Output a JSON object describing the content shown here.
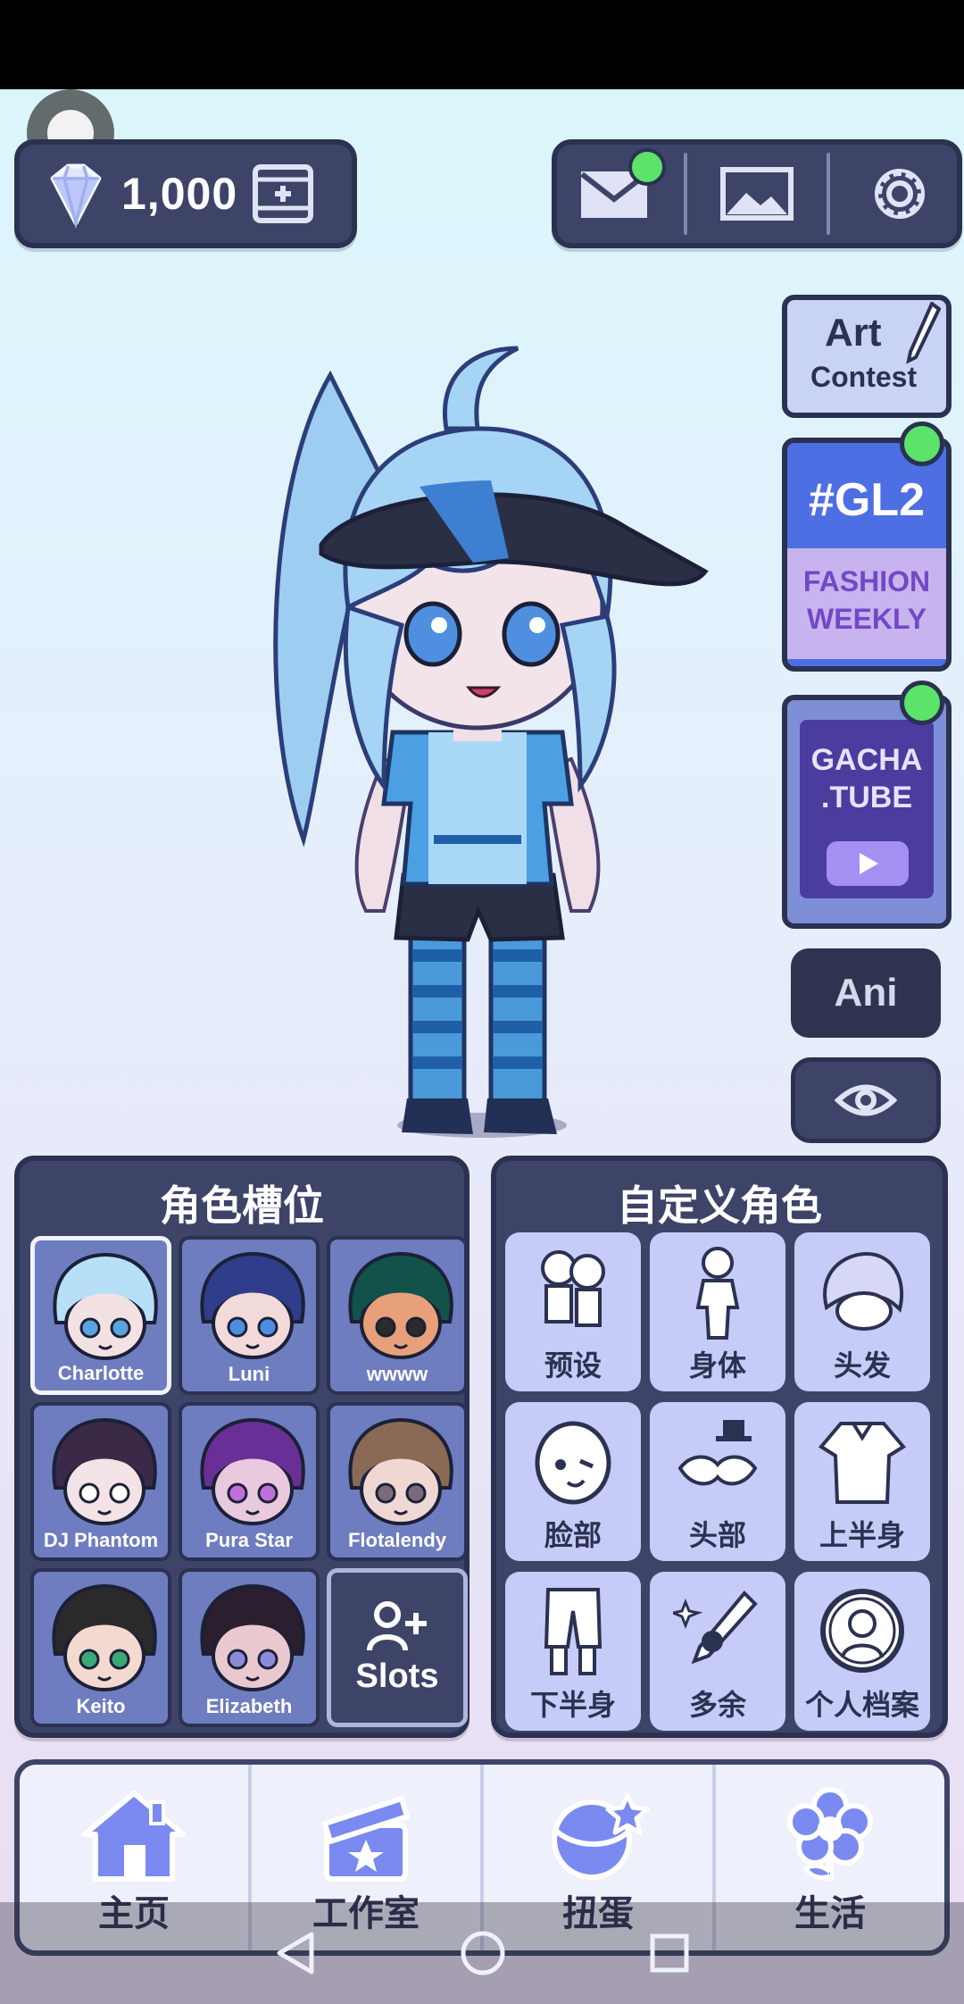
{
  "currency": {
    "gems": "1,000"
  },
  "top_buttons": [
    "mail-icon",
    "gallery-icon",
    "gear-icon"
  ],
  "side": {
    "art_contest": {
      "line1": "Art",
      "line2": "Contest"
    },
    "gl2": {
      "title": "#GL2",
      "line1": "FASHION",
      "line2": "WEEKLY"
    },
    "gacha_tube": {
      "line1": "GACHA",
      "line2": ".TUBE"
    },
    "ani_label": "Ani"
  },
  "slots_panel": {
    "title": "角色槽位",
    "slots": [
      {
        "name": "Charlotte",
        "hair": "#b7dff7",
        "skin": "#f3e2e4",
        "eye": "#5aa4de"
      },
      {
        "name": "Luni",
        "hair": "#2f3d8a",
        "skin": "#f3dada",
        "eye": "#4d8ee3"
      },
      {
        "name": "wwww",
        "hair": "#12524a",
        "skin": "#e8a07a",
        "eye": "#2b2b2b"
      },
      {
        "name": "DJ Phantom",
        "hair": "#3a2a48",
        "skin": "#f3e2e6",
        "eye": "#ffffff"
      },
      {
        "name": "Pura Star",
        "hair": "#6a2f96",
        "skin": "#e9c9de",
        "eye": "#c070d8"
      },
      {
        "name": "Flotalendy",
        "hair": "#8a6a55",
        "skin": "#efd7d3",
        "eye": "#7c6a7a"
      },
      {
        "name": "Keito",
        "hair": "#2a2a2a",
        "skin": "#f3d9cf",
        "eye": "#3aa877"
      },
      {
        "name": "Elizabeth",
        "hair": "#2b1e2e",
        "skin": "#e9c9cf",
        "eye": "#8d8bd9"
      }
    ],
    "add_label": "Slots"
  },
  "custom_panel": {
    "title": "自定义角色",
    "items": [
      {
        "label": "预设",
        "icon": "preset-icon"
      },
      {
        "label": "身体",
        "icon": "body-icon"
      },
      {
        "label": "头发",
        "icon": "hair-icon"
      },
      {
        "label": "脸部",
        "icon": "face-icon"
      },
      {
        "label": "头部",
        "icon": "head-accessory-icon"
      },
      {
        "label": "上半身",
        "icon": "top-icon"
      },
      {
        "label": "下半身",
        "icon": "bottom-icon"
      },
      {
        "label": "多余",
        "icon": "extra-icon"
      },
      {
        "label": "个人档案",
        "icon": "profile-icon"
      }
    ]
  },
  "bottom_nav": [
    {
      "label": "主页",
      "icon": "home-icon"
    },
    {
      "label": "工作室",
      "icon": "clapperboard-icon"
    },
    {
      "label": "扭蛋",
      "icon": "gacha-ball-icon"
    },
    {
      "label": "生活",
      "icon": "flower-icon"
    }
  ],
  "colors": {
    "panel": "#3d4468",
    "border": "#2b3150",
    "accent": "#6e7cc0",
    "notify": "#5be36a"
  }
}
